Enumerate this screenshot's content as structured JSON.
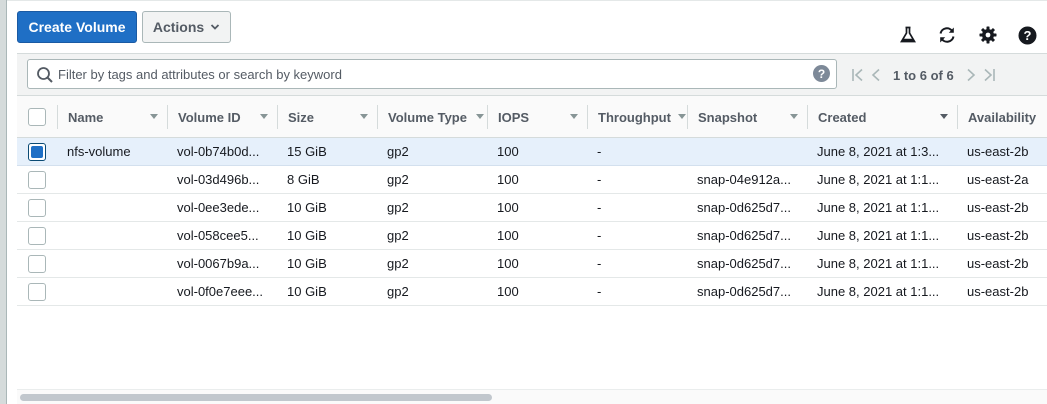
{
  "toolbar": {
    "create_label": "Create Volume",
    "actions_label": "Actions",
    "icons": [
      "flask-icon",
      "refresh-icon",
      "gear-icon",
      "help-icon"
    ]
  },
  "filter": {
    "placeholder": "Filter by tags and attributes or search by keyword",
    "help": "?"
  },
  "pagination": {
    "label": "1 to 6 of 6"
  },
  "columns": [
    "Name",
    "Volume ID",
    "Size",
    "Volume Type",
    "IOPS",
    "Throughput",
    "Snapshot",
    "Created",
    "Availability"
  ],
  "rows": [
    {
      "selected": true,
      "name": "nfs-volume",
      "volume_id": "vol-0b74b0d...",
      "size": "15 GiB",
      "type": "gp2",
      "iops": "100",
      "throughput": "-",
      "snapshot": "",
      "created": "June 8, 2021 at 1:3...",
      "az": "us-east-2b"
    },
    {
      "selected": false,
      "name": "",
      "volume_id": "vol-03d496b...",
      "size": "8 GiB",
      "type": "gp2",
      "iops": "100",
      "throughput": "-",
      "snapshot": "snap-04e912a...",
      "created": "June 8, 2021 at 1:1...",
      "az": "us-east-2a"
    },
    {
      "selected": false,
      "name": "",
      "volume_id": "vol-0ee3ede...",
      "size": "10 GiB",
      "type": "gp2",
      "iops": "100",
      "throughput": "-",
      "snapshot": "snap-0d625d7...",
      "created": "June 8, 2021 at 1:1...",
      "az": "us-east-2b"
    },
    {
      "selected": false,
      "name": "",
      "volume_id": "vol-058cee5...",
      "size": "10 GiB",
      "type": "gp2",
      "iops": "100",
      "throughput": "-",
      "snapshot": "snap-0d625d7...",
      "created": "June 8, 2021 at 1:1...",
      "az": "us-east-2b"
    },
    {
      "selected": false,
      "name": "",
      "volume_id": "vol-0067b9a...",
      "size": "10 GiB",
      "type": "gp2",
      "iops": "100",
      "throughput": "-",
      "snapshot": "snap-0d625d7...",
      "created": "June 8, 2021 at 1:1...",
      "az": "us-east-2b"
    },
    {
      "selected": false,
      "name": "",
      "volume_id": "vol-0f0e7eee...",
      "size": "10 GiB",
      "type": "gp2",
      "iops": "100",
      "throughput": "-",
      "snapshot": "snap-0d625d7...",
      "created": "June 8, 2021 at 1:1...",
      "az": "us-east-2b"
    }
  ],
  "colors": {
    "primary": "#1f6fc5",
    "selected_row": "#e6f0fb"
  }
}
